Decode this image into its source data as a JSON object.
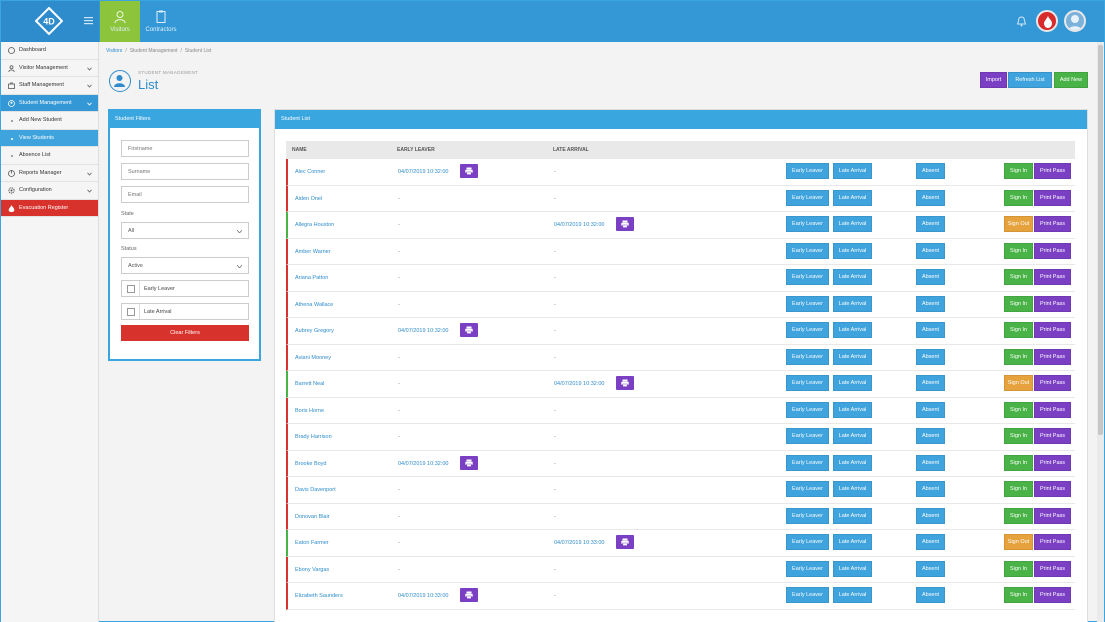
{
  "topbar": {
    "nav": [
      {
        "label": "Visitors",
        "icon": "person-icon"
      },
      {
        "label": "Contractors",
        "icon": "clipboard-icon"
      }
    ],
    "colors": {
      "bar": "#3498d6",
      "active_nav": "#8cc43c",
      "alarm": "#d92b2b"
    }
  },
  "sidebar": {
    "items": [
      {
        "label": "Dashboard",
        "icon": "dashboard-icon",
        "expandable": false
      },
      {
        "label": "Visitor Management",
        "icon": "person-icon",
        "expandable": true
      },
      {
        "label": "Staff Management",
        "icon": "briefcase-icon",
        "expandable": true
      },
      {
        "label": "Student Management",
        "icon": "student-icon",
        "expandable": true,
        "active": true
      },
      {
        "label": "Add New Student",
        "sub": true
      },
      {
        "label": "View Students",
        "sub": true,
        "active": true
      },
      {
        "label": "Absence List",
        "sub": true
      },
      {
        "label": "Reports Manager",
        "icon": "report-icon",
        "expandable": true
      },
      {
        "label": "Configuration",
        "icon": "gear-icon",
        "expandable": true
      },
      {
        "label": "Evacuation Register",
        "icon": "flame-icon",
        "expandable": false,
        "alert": true
      }
    ]
  },
  "breadcrumb": {
    "root": "Visitors",
    "section": "Student Management",
    "page": "Student List"
  },
  "page": {
    "section": "STUDENT MANAGEMENT",
    "title": "List",
    "actions": {
      "import": "Import",
      "refresh": "Refresh List",
      "add": "Add New"
    }
  },
  "filters": {
    "title": "Student Filters",
    "firstname_placeholder": "Firstname",
    "surname_placeholder": "Surname",
    "email_placeholder": "Email",
    "state_label": "State",
    "state_value": "All",
    "status_label": "Status",
    "status_value": "Active",
    "early_leaver": "Early Leaver",
    "late_arrival": "Late Arrival",
    "clear": "Clear Filters"
  },
  "list": {
    "title": "Student List",
    "columns": {
      "name": "NAME",
      "early": "EARLY LEAVER",
      "late": "LATE ARRIVAL"
    },
    "buttons": {
      "early": "Early Leaver",
      "late": "Late Arrival",
      "absent": "Absent",
      "sign_in": "Sign In",
      "sign_out": "Sign Out",
      "print": "Print Pass"
    },
    "rows": [
      {
        "name": "Alec Conner",
        "early": "04/07/2019 10:32:00",
        "late": "-",
        "signed_in": false
      },
      {
        "name": "Aiden Onel",
        "early": "-",
        "late": "-",
        "signed_in": false
      },
      {
        "name": "Allegra Houston",
        "early": "-",
        "late": "04/07/2019 10:32:00",
        "signed_in": true
      },
      {
        "name": "Amber Warner",
        "early": "-",
        "late": "-",
        "signed_in": false
      },
      {
        "name": "Ariana Patton",
        "early": "-",
        "late": "-",
        "signed_in": false
      },
      {
        "name": "Athena Wallace",
        "early": "-",
        "late": "-",
        "signed_in": false
      },
      {
        "name": "Aubrey Gregory",
        "early": "04/07/2019 10:32:00",
        "late": "-",
        "signed_in": false
      },
      {
        "name": "Aviani Mooney",
        "early": "-",
        "late": "-",
        "signed_in": false
      },
      {
        "name": "Barrett Neal",
        "early": "-",
        "late": "04/07/2019 10:32:00",
        "signed_in": true
      },
      {
        "name": "Boris Horne",
        "early": "-",
        "late": "-",
        "signed_in": false
      },
      {
        "name": "Brady Harrison",
        "early": "-",
        "late": "-",
        "signed_in": false
      },
      {
        "name": "Brooke Boyd",
        "early": "04/07/2019 10:32:00",
        "late": "-",
        "signed_in": false
      },
      {
        "name": "Davis Davenport",
        "early": "-",
        "late": "-",
        "signed_in": false
      },
      {
        "name": "Donovan Blair",
        "early": "-",
        "late": "-",
        "signed_in": false
      },
      {
        "name": "Eaton Farmer",
        "early": "-",
        "late": "04/07/2019 10:33:00",
        "signed_in": true
      },
      {
        "name": "Ebony Vargas",
        "early": "-",
        "late": "-",
        "signed_in": false
      },
      {
        "name": "Elizabeth Saunders",
        "early": "04/07/2019 10:33:00",
        "late": "-",
        "signed_in": false
      }
    ]
  }
}
